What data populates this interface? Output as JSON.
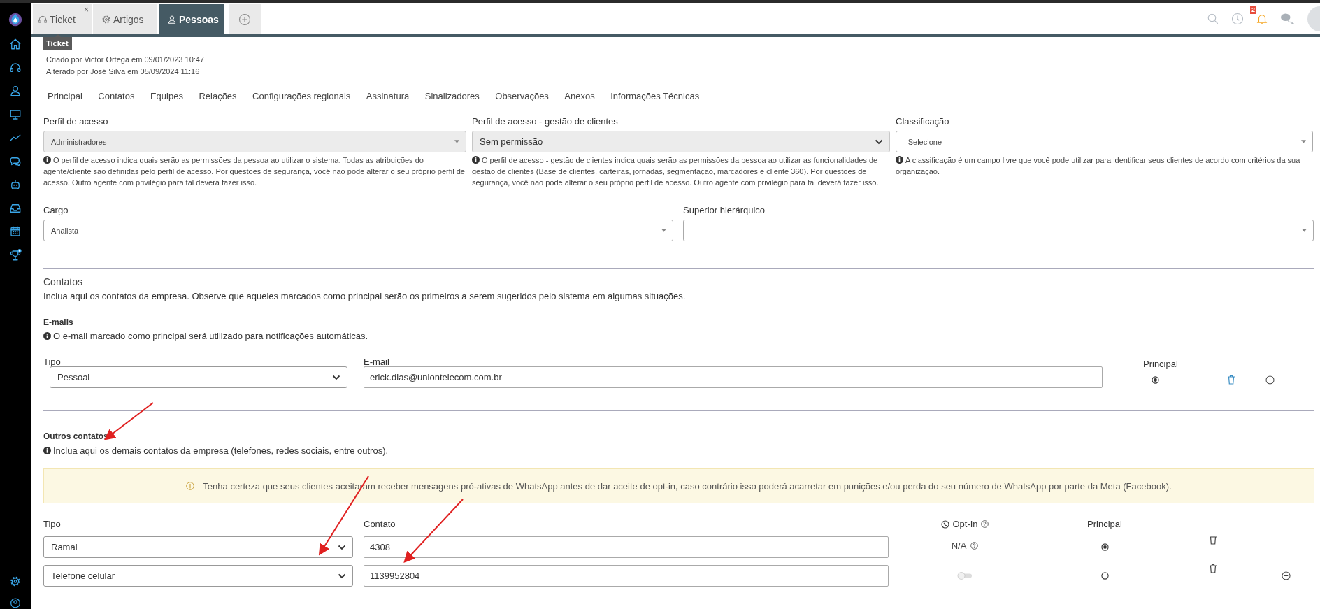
{
  "tabs": [
    {
      "label": "Ticket",
      "selected": false,
      "close": "×"
    },
    {
      "label": "Artigos",
      "selected": false
    },
    {
      "label": "Pessoas",
      "selected": true
    }
  ],
  "tooltip": "Ticket",
  "notifications": {
    "count": "2"
  },
  "meta": [
    "Criado por Victor Ortega em 09/01/2023 10:47",
    "Alterado por José Silva em 05/09/2024 11:16"
  ],
  "section_tabs": [
    "Principal",
    "Contatos",
    "Equipes",
    "Relações",
    "Configurações regionais",
    "Assinatura",
    "Sinalizadores",
    "Observações",
    "Anexos",
    "Informações Técnicas"
  ],
  "access_fields": [
    {
      "label": "Perfil de acesso",
      "value": "Administradores",
      "kind": "combo",
      "disabled": true,
      "help": "O perfil de acesso indica quais serão as permissões da pessoa ao utilizar o sistema. Todas as atribuições do agente/cliente são definidas pelo perfil de acesso. Por questões de segurança, você não pode alterar o seu próprio perfil de acesso. Outro agente com privilégio para tal deverá fazer isso."
    },
    {
      "label": "Perfil de acesso - gestão de clientes",
      "value": "Sem permissão",
      "kind": "select",
      "disabled": true,
      "help": "O perfil de acesso - gestão de clientes indica quais serão as permissões da pessoa ao utilizar as funcionalidades de gestão de clientes (Base de clientes, carteiras, jornadas, segmentação, marcadores e cliente 360). Por questões de segurança, você não pode alterar o seu próprio perfil de acesso. Outro agente com privilégio para tal deverá fazer isso."
    },
    {
      "label": "Classificação",
      "value": "- Selecione -",
      "kind": "combo",
      "disabled": false,
      "help": "A classificação é um campo livre que você pode utilizar para identificar seus clientes de acordo com critérios da sua organização."
    }
  ],
  "role_fields": [
    {
      "label": "Cargo",
      "value": "Analista",
      "kind": "combo",
      "disabled": false
    },
    {
      "label": "Superior hierárquico",
      "kind": "combo",
      "disabled": false
    }
  ],
  "contacts": {
    "title": "Contatos",
    "description": "Inclua aqui os contatos da empresa. Observe que aqueles marcados como principal serão os primeiros a serem sugeridos pelo sistema em algumas situações.",
    "emails": {
      "title": "E-mails",
      "info": "O e-mail marcado como principal será utilizado para notificações automáticas.",
      "columns": [
        "Tipo",
        "E-mail",
        "Principal"
      ],
      "rows": [
        {
          "type": "Pessoal",
          "value": "erick.dias@uniontelecom.com.br",
          "principal": true,
          "add": true
        }
      ]
    },
    "others": {
      "title": "Outros contatos",
      "info": "Inclua aqui os demais contatos da empresa (telefones, redes sociais, entre outros).",
      "warning": "Tenha certeza que seus clientes aceitaram receber mensagens pró-ativas de WhatsApp antes de dar aceite de opt-in, caso contrário isso poderá acarretar em punições e/ou perda do seu número de WhatsApp por parte da Meta (Facebook).",
      "columns": [
        "Tipo",
        "Contato",
        "Opt-In",
        "Principal"
      ],
      "rows": [
        {
          "type": "Ramal",
          "value": "4308",
          "optin": {
            "kind": "text",
            "text": "N/A"
          },
          "principal": true,
          "add": false
        },
        {
          "type": "Telefone celular",
          "value": "1139952804",
          "optin": {
            "kind": "toggle",
            "on": false
          },
          "principal": false,
          "add": true
        }
      ]
    }
  }
}
